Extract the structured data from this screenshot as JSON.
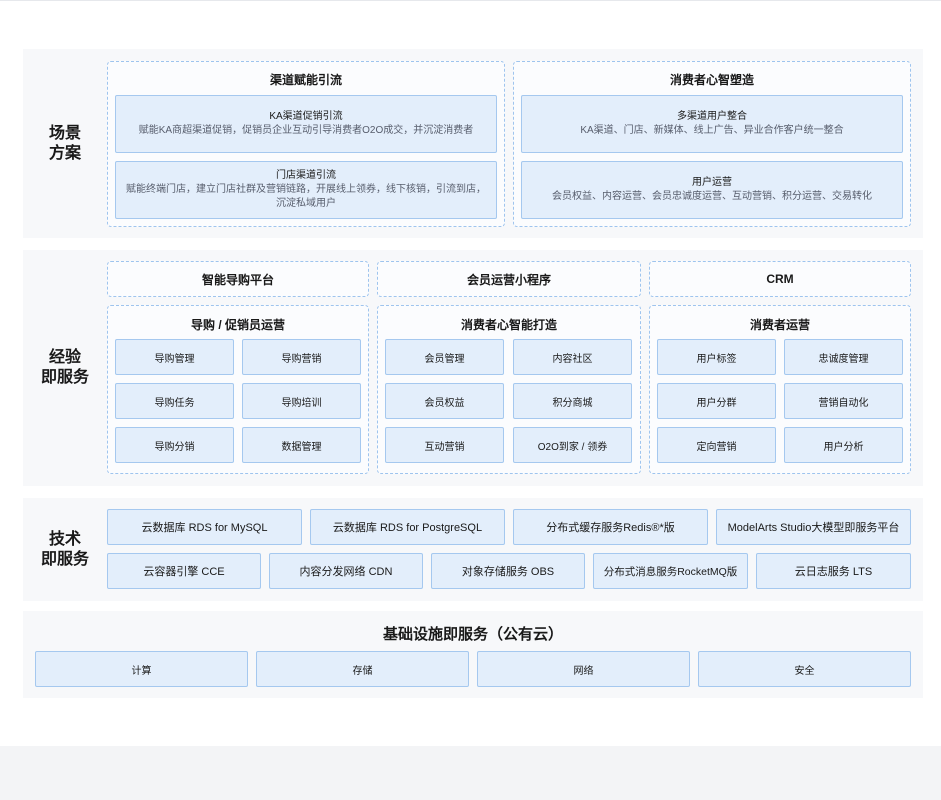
{
  "scenario": {
    "label_line1": "场景",
    "label_line2": "方案",
    "groups": [
      {
        "title": "渠道赋能引流",
        "cards": [
          {
            "title": "KA渠道促销引流",
            "desc": "赋能KA商超渠道促销，促销员企业互动引导消费者O2O成交，并沉淀消费者"
          },
          {
            "title": "门店渠道引流",
            "desc": "赋能终端门店，建立门店社群及营销链路，开展线上领券，线下核销，引流到店，沉淀私域用户"
          }
        ]
      },
      {
        "title": "消费者心智塑造",
        "cards": [
          {
            "title": "多渠道用户整合",
            "desc": "KA渠道、门店、新媒体、线上广告、异业合作客户统一整合"
          },
          {
            "title": "用户运营",
            "desc": "会员权益、内容运营、会员忠诚度运营、互动营销、积分运营、交易转化"
          }
        ]
      }
    ]
  },
  "experience": {
    "label_line1": "经验",
    "label_line2": "即服务",
    "platforms": [
      "智能导购平台",
      "会员运营小程序",
      "CRM"
    ],
    "groups": [
      {
        "title": "导购 / 促销员运营",
        "items": [
          "导购管理",
          "导购营销",
          "导购任务",
          "导购培训",
          "导购分销",
          "数据管理"
        ]
      },
      {
        "title": "消费者心智能打造",
        "items": [
          "会员管理",
          "内容社区",
          "会员权益",
          "积分商城",
          "互动营销",
          "O2O到家 / 领券"
        ]
      },
      {
        "title": "消费者运营",
        "items": [
          "用户标签",
          "忠诚度管理",
          "用户分群",
          "营销自动化",
          "定向营销",
          "用户分析"
        ]
      }
    ]
  },
  "tech": {
    "label_line1": "技术",
    "label_line2": "即服务",
    "row1": [
      "云数据库 RDS for MySQL",
      "云数据库 RDS for PostgreSQL",
      "分布式缓存服务Redis®*版",
      "ModelArts Studio大模型即服务平台"
    ],
    "row2": [
      "云容器引擎 CCE",
      "内容分发网络 CDN",
      "对象存储服务 OBS",
      "分布式消息服务RocketMQ版",
      "云日志服务 LTS"
    ]
  },
  "infra": {
    "title": "基础设施即服务（公有云）",
    "items": [
      "计算",
      "存储",
      "网络",
      "安全"
    ]
  }
}
